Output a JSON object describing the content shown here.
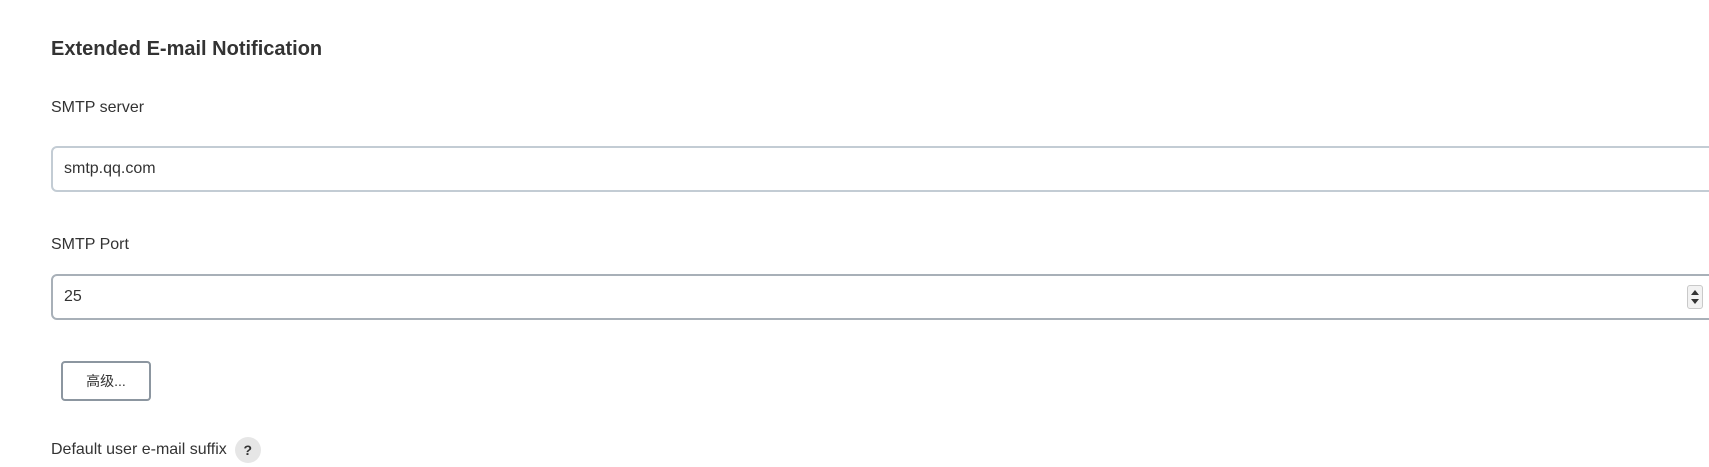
{
  "section": {
    "title": "Extended E-mail Notification"
  },
  "smtp_server": {
    "label": "SMTP server",
    "value": "smtp.qq.com"
  },
  "smtp_port": {
    "label": "SMTP Port",
    "value": "25"
  },
  "advanced_button": {
    "label": "高级..."
  },
  "default_suffix": {
    "label": "Default user e-mail suffix",
    "help_glyph": "?"
  },
  "icons": {
    "help": "question-mark-icon",
    "spinner": "number-spinner-icon"
  },
  "colors": {
    "background": "#ffffff",
    "text": "#333333",
    "input_border": "#c3ccd4",
    "button_border": "#8c96a0",
    "help_bg": "#e6e6e6"
  }
}
